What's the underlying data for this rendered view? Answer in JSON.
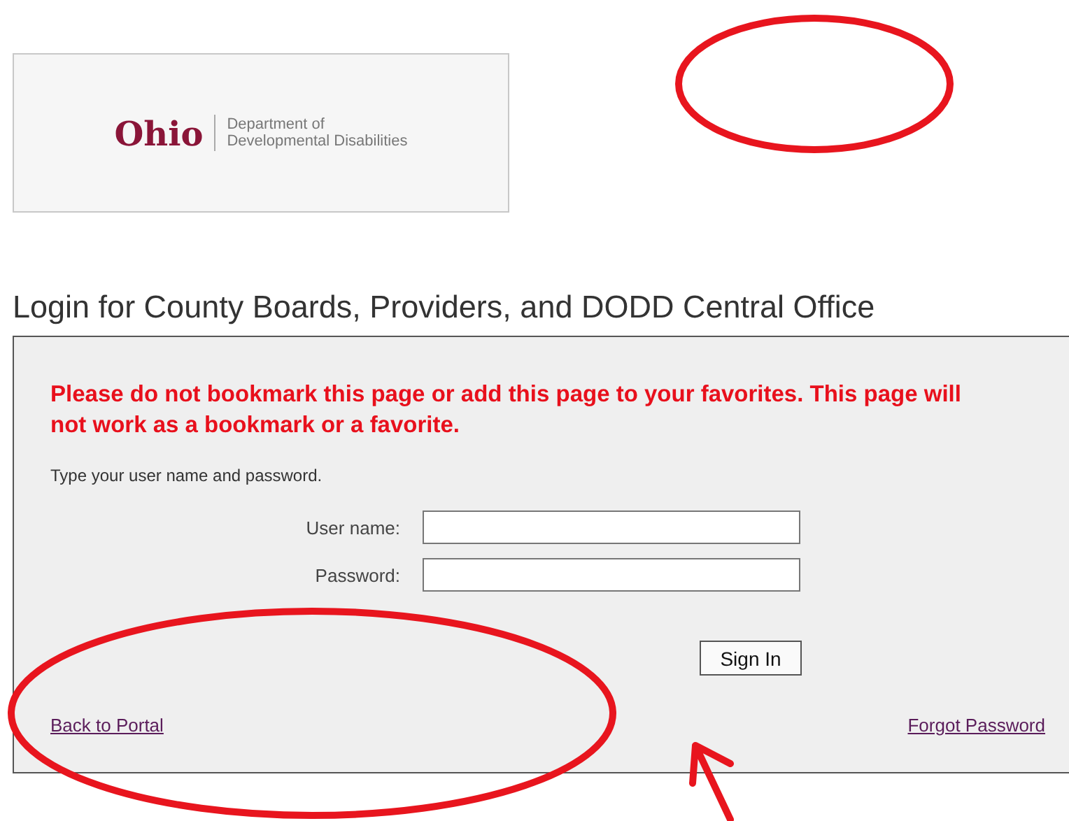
{
  "logo": {
    "wordmark": "Ohio",
    "department": [
      "Department of",
      "Developmental Disabilities"
    ]
  },
  "title": "Login for County Boards, Providers, and DODD Central Office",
  "login_panel": {
    "notice": "Please do not bookmark this page or add this page to your favorites. This page will not work as a bookmark or a favorite.",
    "instruction": "Type your user name and password.",
    "fields": [
      {
        "label": "User name:"
      },
      {
        "label": "Password:"
      }
    ],
    "sign_in_button": "Sign In",
    "links": [
      {
        "label": "Back to Portal"
      },
      {
        "label": "Forgot Password"
      }
    ]
  }
}
